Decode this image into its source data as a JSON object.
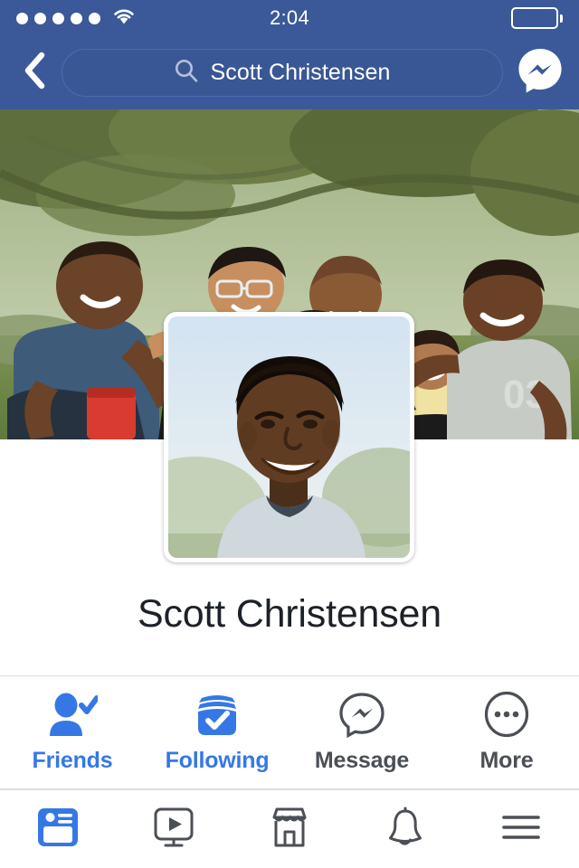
{
  "status_bar": {
    "signal_dots": 5,
    "signal_icon": "signal-dots-icon",
    "wifi_icon": "wifi-icon",
    "time": "2:04",
    "battery_icon": "battery-icon"
  },
  "nav_header": {
    "back_icon": "back-chevron-icon",
    "search": {
      "icon": "search-icon",
      "value": "Scott Christensen",
      "placeholder": "Search"
    },
    "messenger_icon": "messenger-icon"
  },
  "profile": {
    "cover_photo_alt": "group-of-friends-outdoors-cover-photo",
    "profile_photo_alt": "smiling-man-profile-photo",
    "name": "Scott Christensen"
  },
  "action_bar": {
    "items": [
      {
        "label": "Friends",
        "icon": "friend-check-icon",
        "state": "active"
      },
      {
        "label": "Following",
        "icon": "following-box-icon",
        "state": "active"
      },
      {
        "label": "Message",
        "icon": "messenger-outline-icon",
        "state": "inactive"
      },
      {
        "label": "More",
        "icon": "ellipsis-circle-icon",
        "state": "inactive"
      }
    ]
  },
  "bottom_nav": {
    "items": [
      {
        "name": "news-feed",
        "icon": "news-feed-icon",
        "state": "active"
      },
      {
        "name": "watch",
        "icon": "watch-video-icon",
        "state": "inactive"
      },
      {
        "name": "marketplace",
        "icon": "marketplace-icon",
        "state": "inactive"
      },
      {
        "name": "notifications",
        "icon": "bell-icon",
        "state": "inactive"
      },
      {
        "name": "menu",
        "icon": "hamburger-menu-icon",
        "state": "inactive"
      }
    ]
  },
  "colors": {
    "brand_blue": "#3b5998",
    "accent_blue": "#3578e5",
    "icon_grey": "#4b4f56",
    "text_dark": "#1d2129",
    "divider": "#dcdee2"
  }
}
